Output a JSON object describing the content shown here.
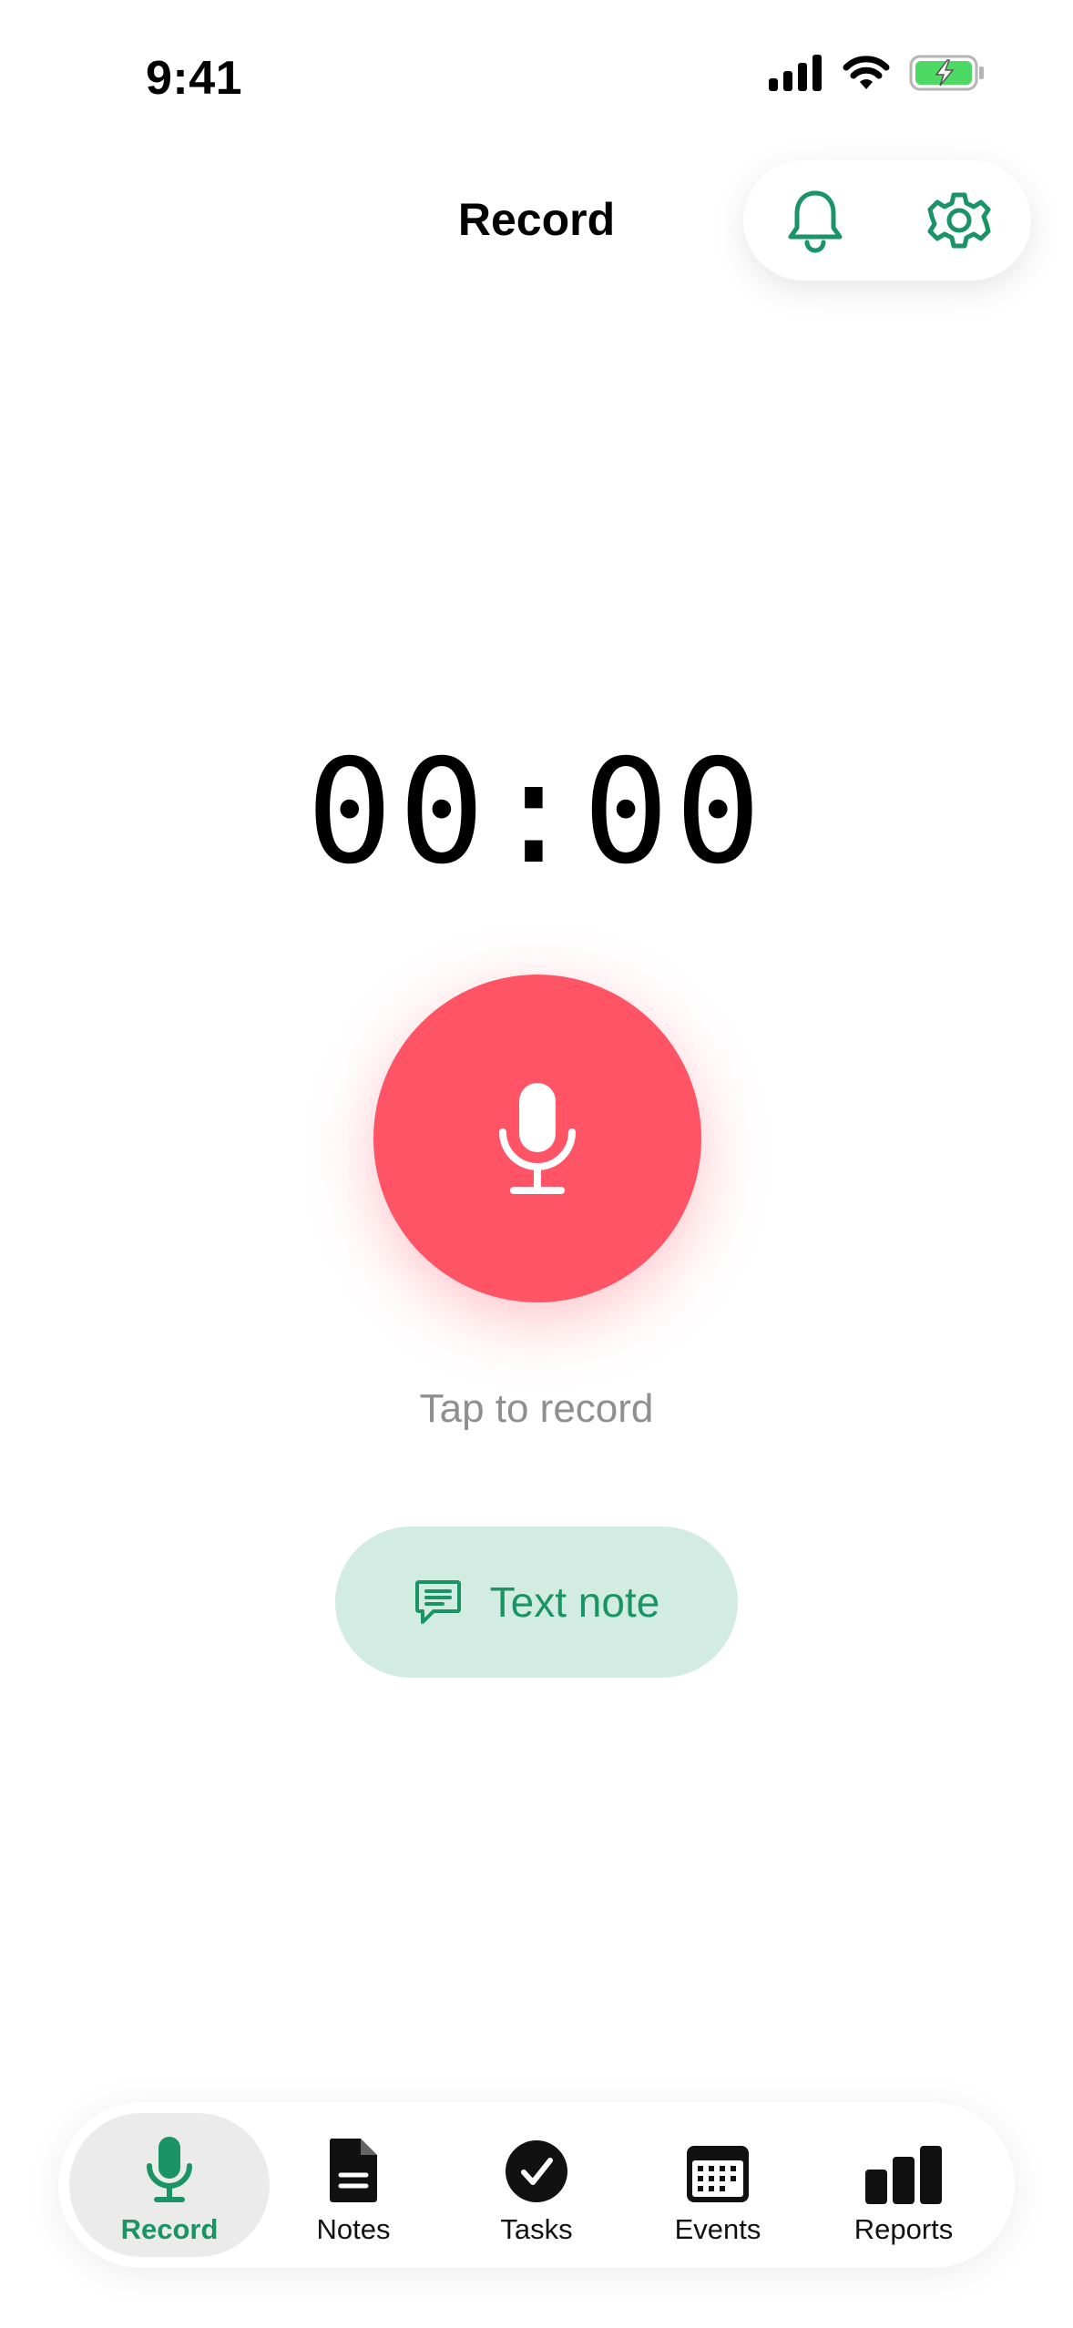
{
  "status_bar": {
    "time": "9:41"
  },
  "header": {
    "title": "Record"
  },
  "recorder": {
    "timer": "00:00",
    "hint": "Tap to record"
  },
  "text_note": {
    "label": "Text note"
  },
  "tabs": [
    {
      "label": "Record",
      "icon": "microphone-icon",
      "active": true
    },
    {
      "label": "Notes",
      "icon": "document-icon",
      "active": false
    },
    {
      "label": "Tasks",
      "icon": "checkmark-circle-icon",
      "active": false
    },
    {
      "label": "Events",
      "icon": "calendar-icon",
      "active": false
    },
    {
      "label": "Reports",
      "icon": "bar-chart-icon",
      "active": false
    }
  ],
  "colors": {
    "accent": "#1a9466",
    "record": "#ff5465",
    "text_note_bg": "#d3ece3",
    "battery": "#4cd964"
  }
}
